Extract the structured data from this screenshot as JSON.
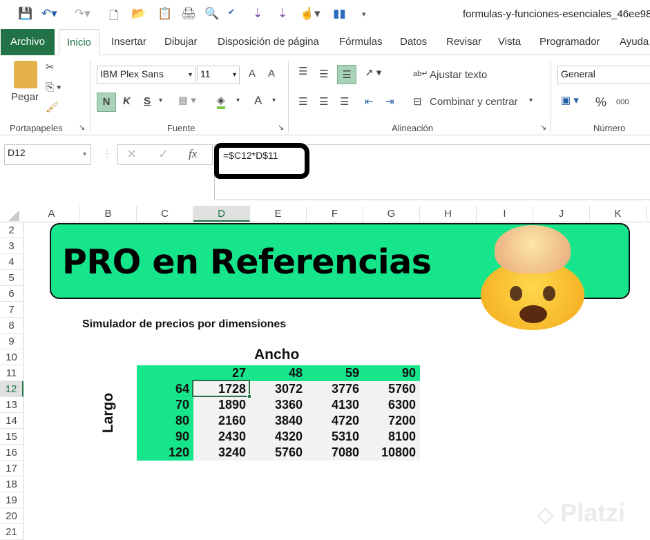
{
  "window": {
    "title": "formulas-y-funciones-esenciales_46ee98l"
  },
  "quick_access": [
    "save-icon",
    "undo-icon",
    "redo-icon",
    "new-icon",
    "open-icon",
    "paste-special-icon",
    "print-icon",
    "print-preview-icon",
    "spelling-icon",
    "sort-asc-icon",
    "sort-desc-icon",
    "touch-mode-icon",
    "chart-icon",
    "customize-icon"
  ],
  "tabs": [
    "Archivo",
    "Inicio",
    "Insertar",
    "Dibujar",
    "Disposición de página",
    "Fórmulas",
    "Datos",
    "Revisar",
    "Vista",
    "Programador",
    "Ayuda"
  ],
  "active_tab": "Inicio",
  "ribbon": {
    "clipboard": {
      "paste": "Pegar",
      "label": "Portapapeles"
    },
    "font": {
      "name": "IBM Plex Sans",
      "size": "11",
      "bold": "N",
      "italic": "K",
      "underline": "S",
      "grow": "A",
      "shrink": "A",
      "color": "A",
      "label": "Fuente"
    },
    "alignment": {
      "wrap": "Ajustar texto",
      "merge": "Combinar y centrar",
      "label": "Alineación"
    },
    "number": {
      "format": "General",
      "percent": "%",
      "thousands": "000",
      "label": "Número"
    }
  },
  "formula_bar": {
    "name_box": "D12",
    "fx": "fx",
    "formula": "=$C12*D$11"
  },
  "columns": [
    "A",
    "B",
    "C",
    "D",
    "E",
    "F",
    "G",
    "H",
    "I",
    "J",
    "K"
  ],
  "active_column": "D",
  "rows": [
    "2",
    "3",
    "4",
    "5",
    "6",
    "7",
    "8",
    "9",
    "10",
    "11",
    "12",
    "13",
    "14",
    "15",
    "16",
    "17",
    "18",
    "19",
    "20",
    "21"
  ],
  "active_row": "12",
  "sheet": {
    "banner": "PRO en Referencias",
    "subtitle": "Simulador de precios por dimensiones",
    "col_axis": "Ancho",
    "row_axis": "Largo",
    "widths": [
      "27",
      "48",
      "59",
      "90"
    ],
    "lengths": [
      "64",
      "70",
      "80",
      "90",
      "120"
    ],
    "values": [
      [
        "1728",
        "3072",
        "3776",
        "5760"
      ],
      [
        "1890",
        "3360",
        "4130",
        "6300"
      ],
      [
        "2160",
        "3840",
        "4720",
        "7200"
      ],
      [
        "2430",
        "4320",
        "5310",
        "8100"
      ],
      [
        "3240",
        "5760",
        "7080",
        "10800"
      ]
    ],
    "accent": "#16e58c"
  },
  "watermark": "Platzi"
}
